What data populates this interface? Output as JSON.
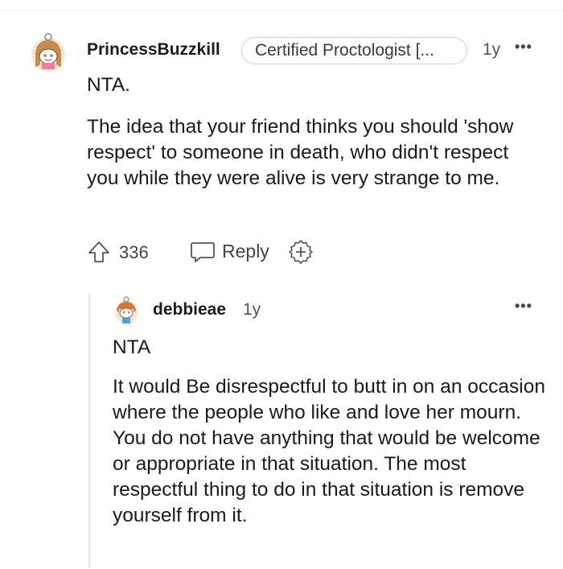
{
  "comment": {
    "username": "PrincessBuzzkill",
    "flair": "Certified Proctologist [...",
    "age": "1y",
    "more_label": "•••",
    "paragraphs": [
      "NTA.",
      "The idea that your friend thinks you should 'show respect' to someone in death, who didn't respect you while they were alive is very strange to me."
    ],
    "upvotes": "336",
    "reply_label": "Reply"
  },
  "reply": {
    "username": "debbieae",
    "age": "1y",
    "more_label": "•••",
    "paragraphs": [
      "NTA",
      "It would Be disrespectful to butt in on an occasion where the people who like and love her mourn. You do not have anything that would be welcome or appropriate in that situation. The most respectful thing to do in that situation is remove yourself from it."
    ]
  },
  "icons": {
    "upvote": "upvote-arrow-icon",
    "reply": "speech-bubble-icon",
    "award": "award-plus-icon",
    "more": "more-options-icon",
    "avatar": "snoo-avatar-icon"
  }
}
